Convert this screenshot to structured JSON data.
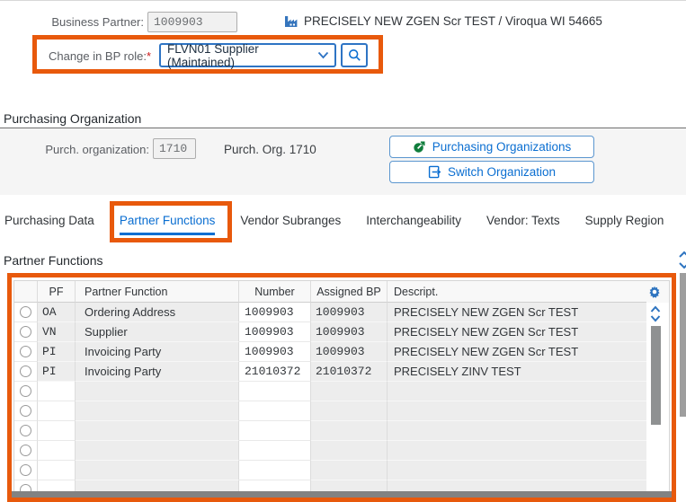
{
  "colors": {
    "highlight_orange": "#E8590C",
    "accent_blue": "#0A6ED1",
    "icon_green": "#0F7D3C",
    "readonly_bg": "#F1F1F1",
    "row_gray": "#EDEDED"
  },
  "top_form": {
    "business_partner": {
      "label": "Business Partner:",
      "value": "1009903"
    },
    "partner_summary": "PRECISELY NEW ZGEN Scr TEST / Viroqua WI 54665",
    "bp_role": {
      "label": "Change in BP role:",
      "required_marker": "*",
      "value": "FLVN01 Supplier (Maintained)"
    }
  },
  "purchasing_organization": {
    "section_title": "Purchasing Organization",
    "purch_org_field": {
      "label": "Purch. organization:",
      "value": "1710"
    },
    "purch_org_text": "Purch. Org. 1710",
    "buttons": {
      "purchasing_organizations": "Purchasing Organizations",
      "switch_organization": "Switch Organization"
    }
  },
  "tabs": [
    {
      "label": "Purchasing Data",
      "active": false
    },
    {
      "label": "Partner Functions",
      "active": true,
      "highlighted": true
    },
    {
      "label": "Vendor Subranges",
      "active": false
    },
    {
      "label": "Interchangeability",
      "active": false
    },
    {
      "label": "Vendor: Texts",
      "active": false
    },
    {
      "label": "Supply Region",
      "active": false
    }
  ],
  "partner_functions": {
    "section_title": "Partner Functions",
    "table": {
      "columns": [
        "PF",
        "Partner Function",
        "Number",
        "Assigned BP",
        "Descript."
      ],
      "rows": [
        {
          "pf": "OA",
          "partner_function": "Ordering Address",
          "number": "1009903",
          "assigned_bp": "1009903",
          "descript": "PRECISELY NEW ZGEN Scr TEST"
        },
        {
          "pf": "VN",
          "partner_function": "Supplier",
          "number": "1009903",
          "assigned_bp": "1009903",
          "descript": "PRECISELY NEW ZGEN Scr TEST"
        },
        {
          "pf": "PI",
          "partner_function": "Invoicing Party",
          "number": "1009903",
          "assigned_bp": "1009903",
          "descript": "PRECISELY NEW ZGEN Scr TEST"
        },
        {
          "pf": "PI",
          "partner_function": "Invoicing Party",
          "number": "21010372",
          "assigned_bp": "21010372",
          "descript": "PRECISELY ZINV TEST"
        }
      ],
      "empty_row_count": 6
    }
  }
}
